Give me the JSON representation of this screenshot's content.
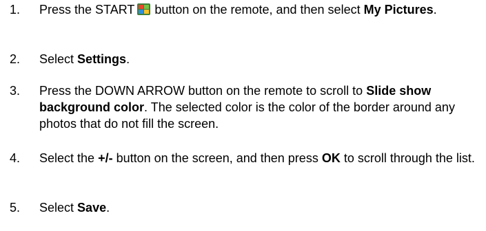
{
  "steps": [
    {
      "number": "1.",
      "text_before_icon": "Press the START",
      "icon": "windows-start-icon",
      "text_after_icon": "button on the remote, and then select",
      "bold": "My Pictures",
      "text_end": "."
    },
    {
      "number": "2.",
      "text_before": "Select",
      "bold": "Settings",
      "text_end": "."
    },
    {
      "number": "3.",
      "text_before": "Press the DOWN ARROW button on the remote to scroll to",
      "bold": "Slide show background color",
      "text_end": ". The selected color is the color of the border around any photos that do not fill the screen."
    },
    {
      "number": "4.",
      "text_before": "Select the",
      "bold_1": "+/-",
      "text_middle": "button on the screen, and then press",
      "bold_2": "OK",
      "text_end": "to scroll through the list."
    },
    {
      "number": "5.",
      "text_before": "Select",
      "bold": "Save",
      "text_end": "."
    }
  ]
}
